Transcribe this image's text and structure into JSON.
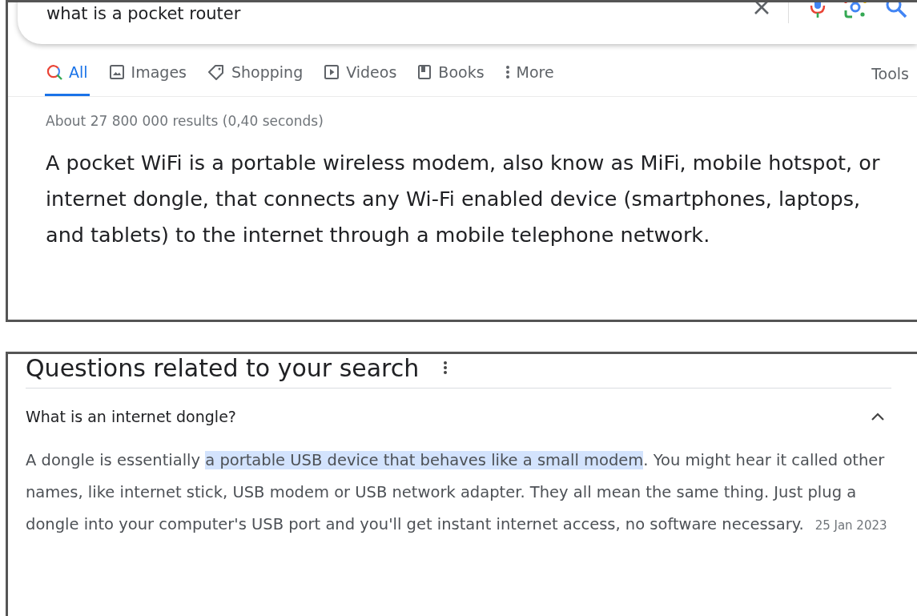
{
  "search": {
    "value": "what is a pocket router"
  },
  "tabs": [
    {
      "label": "All",
      "kind": "all",
      "selected": true
    },
    {
      "label": "Images",
      "kind": "images",
      "selected": false
    },
    {
      "label": "Shopping",
      "kind": "shopping",
      "selected": false
    },
    {
      "label": "Videos",
      "kind": "videos",
      "selected": false
    },
    {
      "label": "Books",
      "kind": "books",
      "selected": false
    },
    {
      "label": "More",
      "kind": "more",
      "selected": false
    }
  ],
  "tools": "Tools",
  "result_stats": "About 27 800 000 results (0,40 seconds)",
  "featured_snippet": "A pocket WiFi is a portable wireless modem, also know as MiFi, mobile hotspot, or internet dongle, that connects any Wi-Fi enabled device (smartphones, laptops, and tablets) to the internet through a mobile telephone network.",
  "related": {
    "title": "Questions related to your search",
    "questions": [
      {
        "question": "What is an internet dongle?",
        "expanded": true,
        "answer": [
          {
            "text": "A dongle is essentially ",
            "highlighted": false
          },
          {
            "text": "a portable USB device that behaves like a small modem",
            "highlighted": true
          },
          {
            "text": ". You might hear it called other names, like internet stick, USB modem or USB network adapter. They all mean the same thing. Just plug a dongle into your computer's USB port and you'll get instant internet access, no software necessary.",
            "highlighted": false
          }
        ],
        "date": "25 Jan 2023"
      }
    ]
  }
}
